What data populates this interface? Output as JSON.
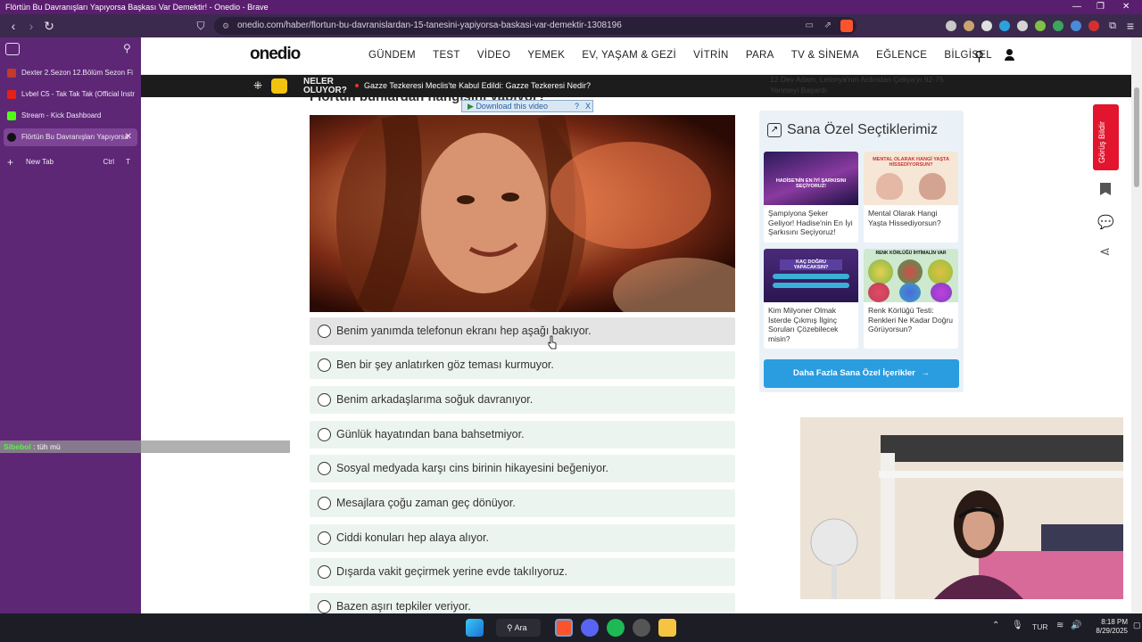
{
  "window": {
    "title": "Flörtün Bu Davranışları Yapıyorsa Başkası Var Demektir! - Onedio - Brave"
  },
  "browser": {
    "url": "onedio.com/haber/flortun-bu-davranislardan-15-tanesini-yapiyorsa-baskasi-var-demektir-1308196"
  },
  "tabs": [
    {
      "label": "Dexter 2.Sezon 12.Bölüm Sezon Fi",
      "color": "#c23a2a"
    },
    {
      "label": "Lvbel C5 - Tak Tak Tak (Official Instr",
      "color": "#e62117"
    },
    {
      "label": "Stream - Kick Dashboard",
      "color": "#53fc18"
    },
    {
      "label": "Flörtün Bu Davranışları Yapıyorsa",
      "color": "#111111"
    }
  ],
  "new_tab": {
    "label": "New Tab",
    "shortcut_ctrl": "Ctrl",
    "shortcut_key": "T"
  },
  "chat_overlay": {
    "user": "Sibebol",
    "message": " : tüh mü"
  },
  "site": {
    "logo": "onedio",
    "menu": [
      "GÜNDEM",
      "TEST",
      "VİDEO",
      "YEMEK",
      "EV, YAŞAM & GEZİ",
      "VİTRİN",
      "PARA",
      "TV & SİNEMA",
      "EĞLENCE",
      "BİLGİSEL"
    ]
  },
  "ticker": {
    "label": "NELER OLUYOR?",
    "headline": "Gazze Tezkeresi Meclis'te Kabul Edildi: Gazze Tezkeresi Nedir?"
  },
  "question_partial": "Flörtün bunlardan hangisini yapıyor?",
  "video_overlay": {
    "label": "Download this video",
    "help": "?",
    "close": "X"
  },
  "options": [
    "Benim yanımda telefonun ekranı hep aşağı bakıyor.",
    "Ben bir şey anlatırken göz teması kurmuyor.",
    "Benim arkadaşlarıma soğuk davranıyor.",
    "Günlük hayatından bana bahsetmiyor.",
    "Sosyal medyada karşı cins birinin hikayesini beğeniyor.",
    "Mesajlara çoğu zaman geç dönüyor.",
    "Ciddi konuları hep alaya alıyor.",
    "Dışarda vakit geçirmek yerine evde takılıyoruz.",
    "Bazen aşırı tepkiler veriyor."
  ],
  "panel": {
    "title": "Sana Özel Seçtiklerimiz",
    "cards": [
      {
        "text": "Şampiyona Şeker Geliyor! Hadise'nin En İyi Şarkısını Seçiyoruz!",
        "thumb_text": "HADİSE'NİN EN İYİ ŞARKISINI SEÇİYORUZ!"
      },
      {
        "text": "Mental Olarak Hangi Yaşta Hissediyorsun?",
        "thumb_text": "MENTAL OLARAK HANGİ YAŞTA HİSSEDİYORSUN?"
      },
      {
        "text": "Kim Milyoner Olmak İsterde Çıkmış İlginç Soruları Çözebilecek misin?",
        "thumb_text": "KAÇ DOĞRU YAPACAKSIN?"
      },
      {
        "text": "Renk Körlüğü Testi: Renkleri Ne Kadar Doğru Görüyorsun?",
        "thumb_text": "RENK KÖRLÜĞÜ İHTİMALİN VAR"
      }
    ],
    "cta": "Daha Fazla Sana Özel İçerikler"
  },
  "top_right_partial": "12 Dev Adam, Letonya'nın Ardından Çekya'yı 92-75 Yenmeyi Başardı",
  "feedback": "Görüş Bildir",
  "taskbar": {
    "search": "Ara",
    "lang": "TUR",
    "time": "8:18 PM",
    "date": "8/29/2025"
  }
}
